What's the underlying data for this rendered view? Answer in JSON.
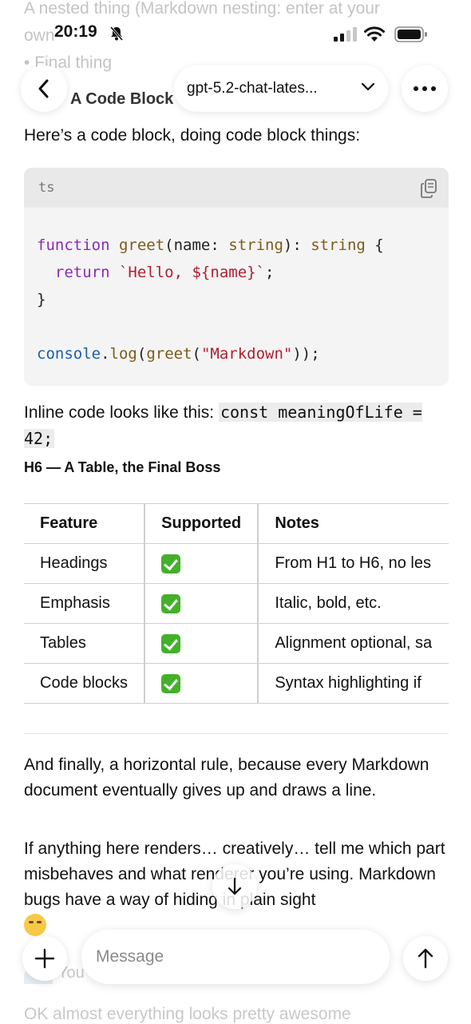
{
  "scrolled_top": {
    "line1": "A nested thing (Markdown nesting: enter at your",
    "line2": "own",
    "bullet": "Final thing"
  },
  "status_bar": {
    "time": "20:19"
  },
  "nav": {
    "model_label": "gpt-5.2-chat-lates...",
    "partial_section_title": "A Code Block"
  },
  "content": {
    "code_intro": "Here’s a code block, doing code block things:",
    "code_block": {
      "lang": "ts",
      "lines": [
        "function greet(name: string): string {",
        "  return `Hello, ${name}`;",
        "}",
        "",
        "console.log(greet(\"Markdown\"));"
      ]
    },
    "inline_code_prefix": "Inline code looks like this: ",
    "inline_code": "const meaningOfLife = 42;",
    "h6": "H6 — A Table, the Final Boss",
    "table": {
      "headers": [
        "Feature",
        "Supported",
        "Notes"
      ],
      "rows": [
        [
          "Headings",
          "✅",
          "From H1 to H6, no les"
        ],
        [
          "Emphasis",
          "✅",
          "Italic, bold, etc."
        ],
        [
          "Tables",
          "✅",
          "Alignment optional, sa"
        ],
        [
          "Code blocks",
          "✅",
          "Syntax highlighting if"
        ]
      ]
    },
    "final_para_1": "And finally, a horizontal rule, because every Markdown document eventually gives up and draws a line.",
    "final_para_2": "If anything here renders… creatively… tell me which part misbehaves and what renderer you’re using. Markdown bugs have a way of hiding in plain sight"
  },
  "composer": {
    "placeholder": "Message"
  },
  "below": {
    "you_label": "You",
    "next_message": "OK almost everything looks pretty awesome"
  }
}
